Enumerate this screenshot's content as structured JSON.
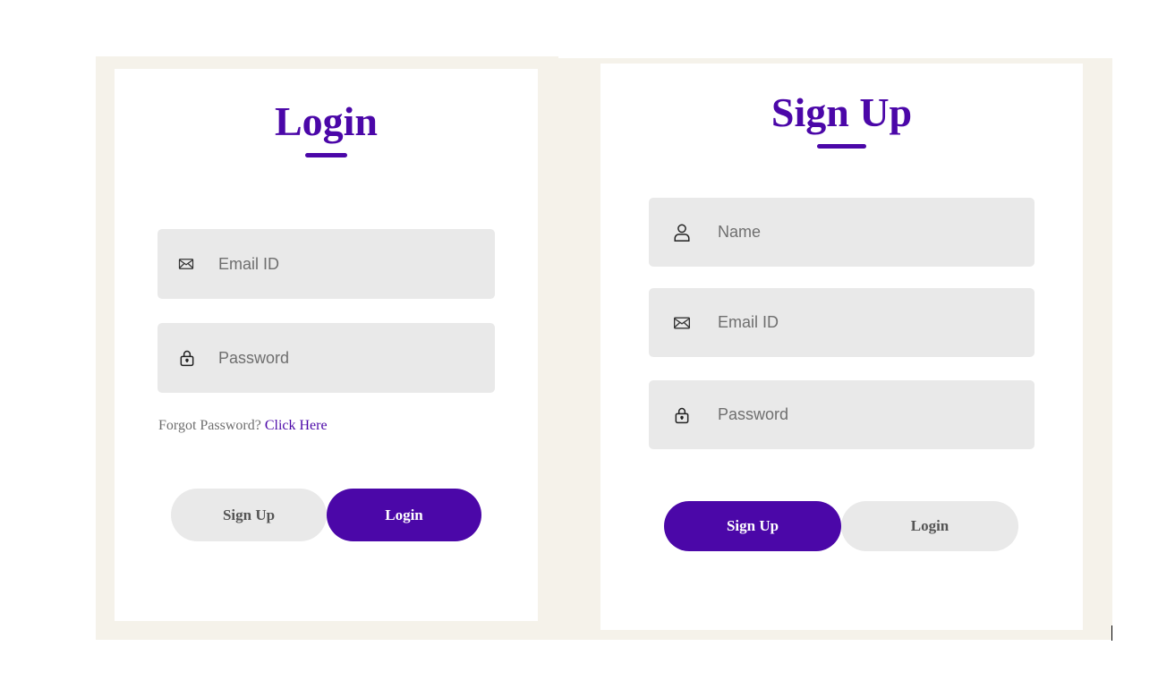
{
  "login": {
    "title": "Login",
    "fields": {
      "email_placeholder": "Email ID",
      "password_placeholder": "Password"
    },
    "forgot_text": "Forgot Password?",
    "forgot_link": "Click Here",
    "buttons": {
      "signup_label": "Sign Up",
      "login_label": "Login"
    }
  },
  "signup": {
    "title": "Sign Up",
    "fields": {
      "name_placeholder": "Name",
      "email_placeholder": "Email ID",
      "password_placeholder": "Password"
    },
    "buttons": {
      "signup_label": "Sign Up",
      "login_label": "Login"
    }
  },
  "icons": {
    "email": "envelope-icon",
    "password": "lock-icon",
    "name": "user-icon"
  },
  "colors": {
    "accent": "#4b07a8",
    "panel_bg": "#f5f2ea",
    "field_bg": "#e9e9e9"
  }
}
